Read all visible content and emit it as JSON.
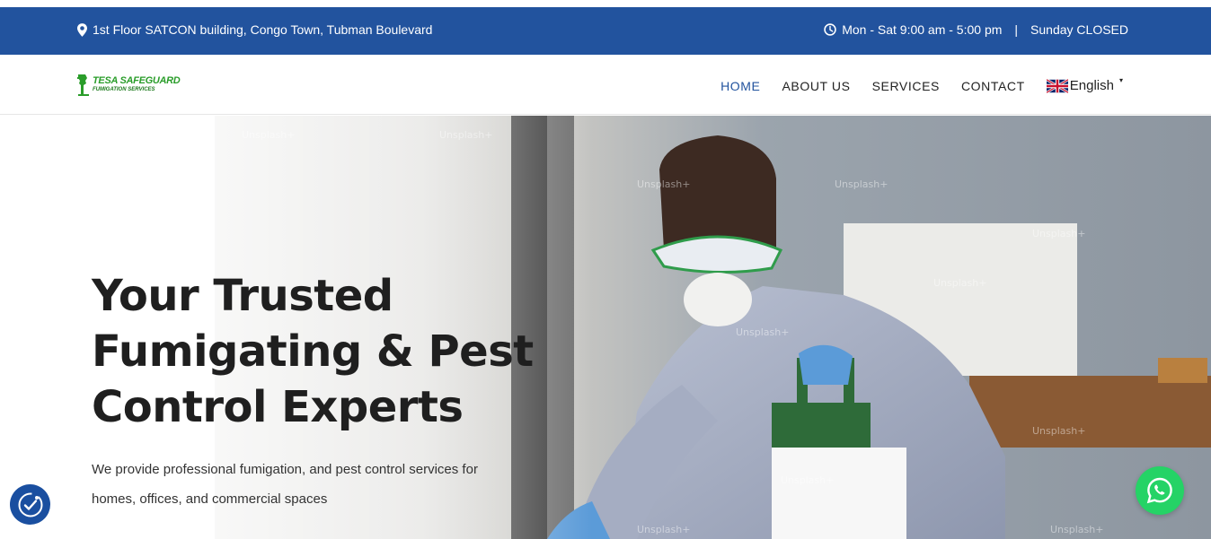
{
  "topbar": {
    "address": "1st Floor SATCON building, Congo Town, Tubman Boulevard",
    "hours": "Mon - Sat 9:00 am - 5:00 pm",
    "separator": "|",
    "closed": "Sunday CLOSED",
    "location_icon": "map-pin-icon",
    "clock_icon": "clock-icon",
    "background_color": "#22539e"
  },
  "logo": {
    "line1": "TESA SAFEGUARD",
    "line2": "FUMIGATION SERVICES",
    "color": "#2a9d2a"
  },
  "nav": {
    "items": [
      {
        "label": "HOME",
        "active": true
      },
      {
        "label": "ABOUT US",
        "active": false
      },
      {
        "label": "SERVICES",
        "active": false
      },
      {
        "label": "CONTACT",
        "active": false
      }
    ],
    "language": "English",
    "language_flag_icon": "uk-flag-icon",
    "language_caret": "▾",
    "active_color": "#22539e"
  },
  "hero": {
    "heading_line1": "Your Trusted",
    "heading_line2": "Fumigating & Pest",
    "heading_line3": "Control Experts",
    "subtext": "We provide professional fumigation, and pest control services for homes, offices, and commercial spaces",
    "watermark": "Unsplash+"
  },
  "widgets": {
    "accessibility_icon": "accessibility-icon",
    "whatsapp_icon": "whatsapp-icon",
    "whatsapp_color": "#25d366"
  }
}
